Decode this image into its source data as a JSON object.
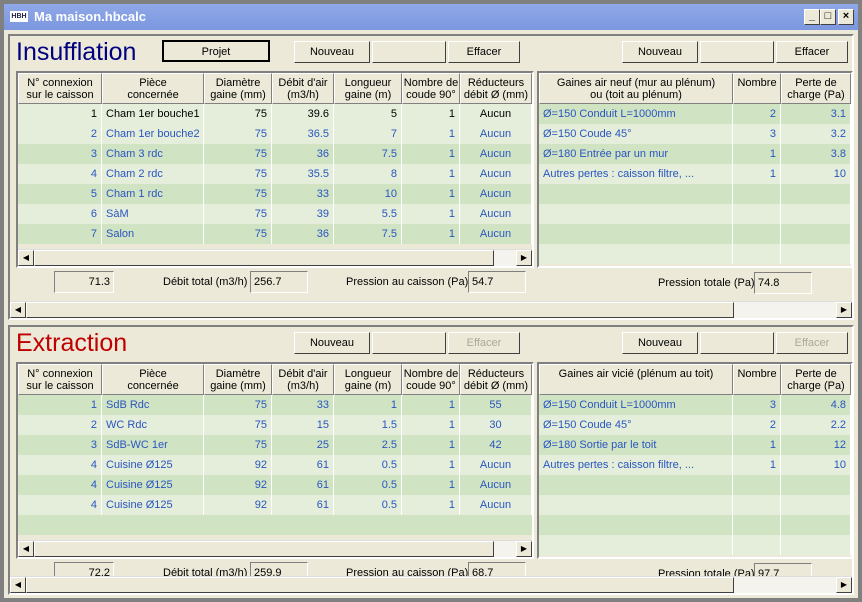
{
  "window": {
    "title": "Ma maison.hbcalc",
    "icon_text": "HBH",
    "min": "_",
    "max": "□",
    "close": "×"
  },
  "sections": [
    {
      "id": "insufflation",
      "title": "Insufflation",
      "title_color": "#000080",
      "projet": "Projet",
      "left_buttons": {
        "new": "Nouveau",
        "blank": "",
        "clear": "Effacer",
        "clear_disabled": false
      },
      "right_buttons": {
        "new": "Nouveau",
        "blank": "",
        "clear": "Effacer",
        "clear_disabled": false
      },
      "columns": [
        "N° connexion\nsur le caisson",
        "Pièce\nconcernée",
        "Diamètre\ngaine (mm)",
        "Débit d'air\n(m3/h)",
        "Longueur\ngaine (m)",
        "Nombre de\ncoude 90°",
        "Réducteurs\ndébit Ø (mm)"
      ],
      "rows": [
        [
          "1",
          "Cham 1er bouche1",
          "75",
          "39.6",
          "5",
          "1",
          "Aucun"
        ],
        [
          "2",
          "Cham 1er bouche2",
          "75",
          "36.5",
          "7",
          "1",
          "Aucun"
        ],
        [
          "3",
          "Cham 3 rdc",
          "75",
          "36",
          "7.5",
          "1",
          "Aucun"
        ],
        [
          "4",
          "Cham 2 rdc",
          "75",
          "35.5",
          "8",
          "1",
          "Aucun"
        ],
        [
          "5",
          "Cham 1 rdc",
          "75",
          "33",
          "10",
          "1",
          "Aucun"
        ],
        [
          "6",
          "SàM",
          "75",
          "39",
          "5.5",
          "1",
          "Aucun"
        ],
        [
          "7",
          "Salon",
          "75",
          "36",
          "7.5",
          "1",
          "Aucun"
        ]
      ],
      "right_columns": [
        "Gaines air neuf (mur au plénum)\nou (toit au plénum)",
        "Nombre",
        "Perte de\ncharge (Pa)"
      ],
      "right_rows": [
        [
          "Ø=150 Conduit L=1000mm",
          "2",
          "3.1"
        ],
        [
          "Ø=150 Coude 45°",
          "3",
          "3.2"
        ],
        [
          "Ø=180 Entrée par un mur",
          "1",
          "3.8"
        ],
        [
          "Autres pertes : caisson filtre, ...",
          "1",
          "10"
        ]
      ],
      "field1": "71.3",
      "debit_label": "Débit total (m3/h)",
      "debit": "256.7",
      "pression_caisson_label": "Pression au caisson (Pa)",
      "pression_caisson": "54.7",
      "pression_totale_label": "Pression totale (Pa)",
      "pression_totale": "74.8"
    },
    {
      "id": "extraction",
      "title": "Extraction",
      "title_color": "#c00000",
      "left_buttons": {
        "new": "Nouveau",
        "blank": "",
        "clear": "Effacer",
        "clear_disabled": true
      },
      "right_buttons": {
        "new": "Nouveau",
        "blank": "",
        "clear": "Effacer",
        "clear_disabled": true
      },
      "columns": [
        "N° connexion\nsur le caisson",
        "Pièce\nconcernée",
        "Diamètre\ngaine (mm)",
        "Débit d'air\n(m3/h)",
        "Longueur\ngaine (m)",
        "Nombre de\ncoude 90°",
        "Réducteurs\ndébit Ø (mm)"
      ],
      "rows": [
        [
          "1",
          "SdB Rdc",
          "75",
          "33",
          "1",
          "1",
          "55"
        ],
        [
          "2",
          "WC Rdc",
          "75",
          "15",
          "1.5",
          "1",
          "30"
        ],
        [
          "3",
          "SdB-WC 1er",
          "75",
          "25",
          "2.5",
          "1",
          "42"
        ],
        [
          "4",
          "Cuisine Ø125",
          "92",
          "61",
          "0.5",
          "1",
          "Aucun"
        ],
        [
          "4",
          "Cuisine Ø125",
          "92",
          "61",
          "0.5",
          "1",
          "Aucun"
        ],
        [
          "4",
          "Cuisine Ø125",
          "92",
          "61",
          "0.5",
          "1",
          "Aucun"
        ]
      ],
      "right_columns": [
        "Gaines air vicié (plénum au toit)",
        "Nombre",
        "Perte de\ncharge (Pa)"
      ],
      "right_rows": [
        [
          "Ø=150 Conduit L=1000mm",
          "3",
          "4.8"
        ],
        [
          "Ø=150 Coude 45°",
          "2",
          "2.2"
        ],
        [
          "Ø=180 Sortie par le toit",
          "1",
          "12"
        ],
        [
          "Autres pertes : caisson filtre, ...",
          "1",
          "10"
        ]
      ],
      "field1": "72.2",
      "debit_label": "Débit total (m3/h)",
      "debit": "259.9",
      "pression_caisson_label": "Pression au caisson (Pa)",
      "pression_caisson": "68.7",
      "pression_totale_label": "Pression totale (Pa)",
      "pression_totale": "97.7"
    }
  ]
}
